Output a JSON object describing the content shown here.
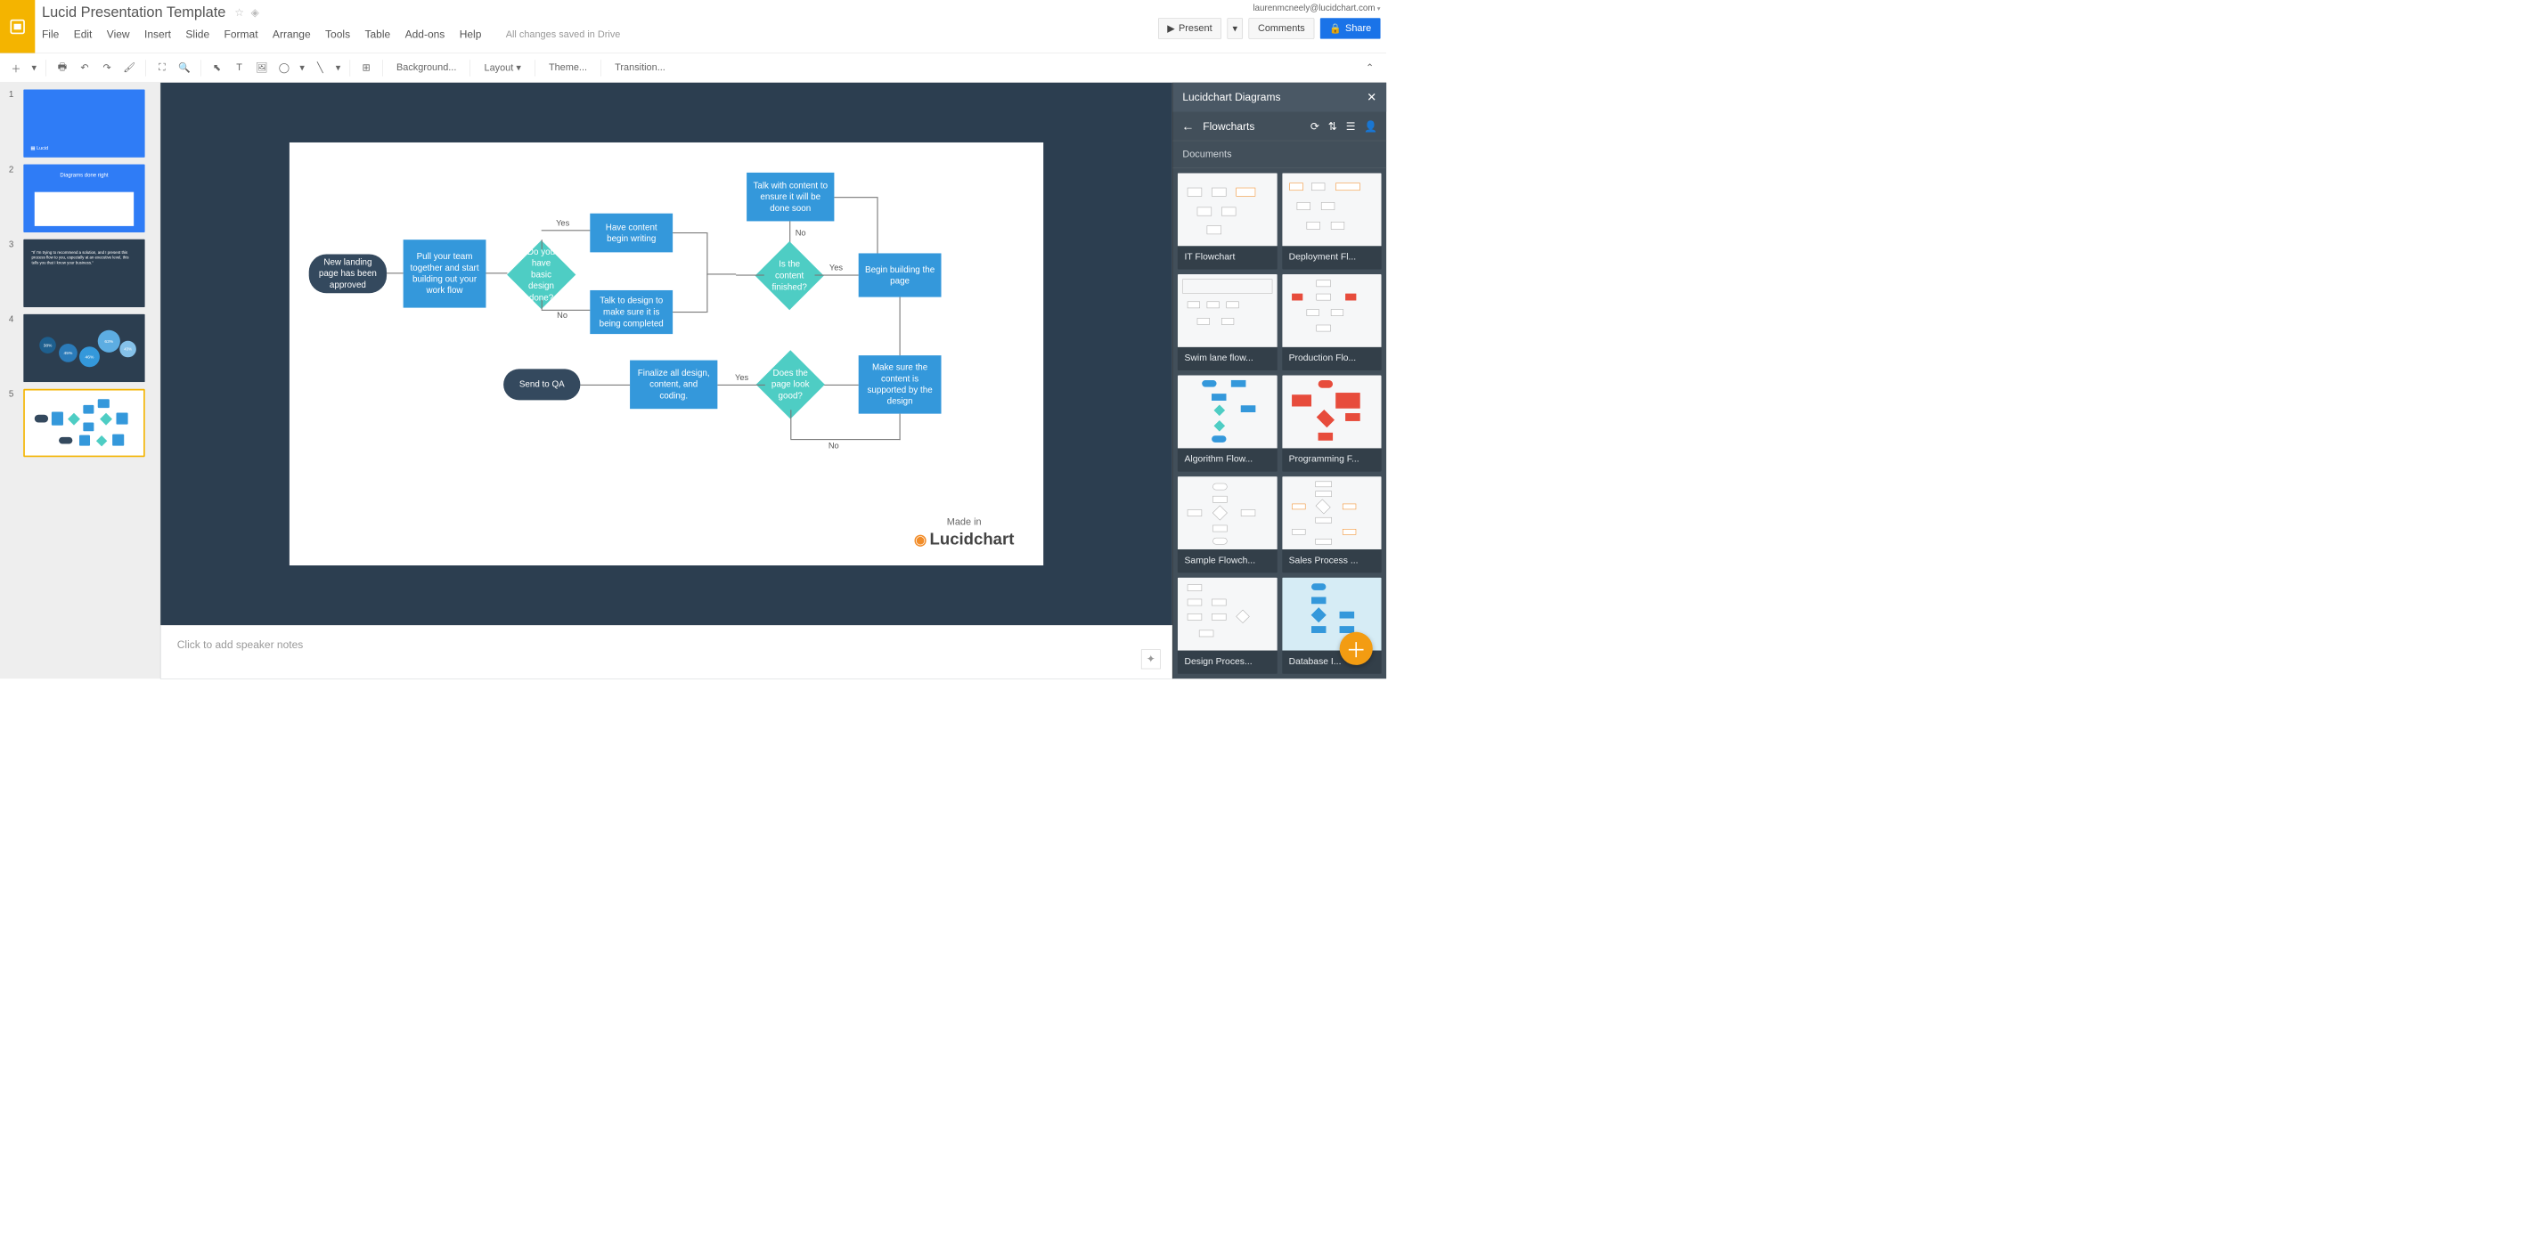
{
  "header": {
    "doc_title": "Lucid Presentation Template",
    "email": "laurenmcneely@lucidchart.com",
    "present": "Present",
    "comments": "Comments",
    "share": "Share"
  },
  "menu": [
    "File",
    "Edit",
    "View",
    "Insert",
    "Slide",
    "Format",
    "Arrange",
    "Tools",
    "Table",
    "Add-ons",
    "Help"
  ],
  "menu_status": "All changes saved in Drive",
  "toolbar_text": {
    "background": "Background...",
    "layout": "Layout",
    "theme": "Theme...",
    "transition": "Transition..."
  },
  "slides": [
    {
      "num": "1",
      "kind": "blue"
    },
    {
      "num": "2",
      "kind": "blue",
      "title": "Diagrams done right"
    },
    {
      "num": "3",
      "kind": "dark",
      "quote": "\"If I'm trying to recommend a solution, and I present this process flow to you, especially at an executive level, this tells you that I know your business.\""
    },
    {
      "num": "4",
      "kind": "dark"
    },
    {
      "num": "5",
      "kind": "white"
    }
  ],
  "flowchart": {
    "start": "New landing page has been approved",
    "pull": "Pull your team together and start building out your work flow",
    "dec1": "Do you have basic design done?",
    "yes": "Yes",
    "no": "No",
    "content_write": "Have content begin writing",
    "talk_design": "Talk to design to make sure it is being completed",
    "talk_content": "Talk with content to ensure it will be done soon",
    "dec2": "Is the content finished?",
    "build": "Begin building the page",
    "support": "Make sure the content is supported by the design",
    "dec3": "Does the page look good?",
    "finalize": "Finalize all design, content, and coding.",
    "qa": "Send to QA",
    "made_in": "Made in",
    "brand": "Lucidchart"
  },
  "notes_placeholder": "Click to add speaker notes",
  "panel": {
    "title": "Lucidchart Diagrams",
    "crumb": "Flowcharts",
    "section": "Documents",
    "docs": [
      "IT Flowchart",
      "Deployment Fl...",
      "Swim lane flow...",
      "Production Flo...",
      "Algorithm Flow...",
      "Programming F...",
      "Sample Flowch...",
      "Sales Process ...",
      "Design Proces...",
      "Database I..."
    ]
  }
}
